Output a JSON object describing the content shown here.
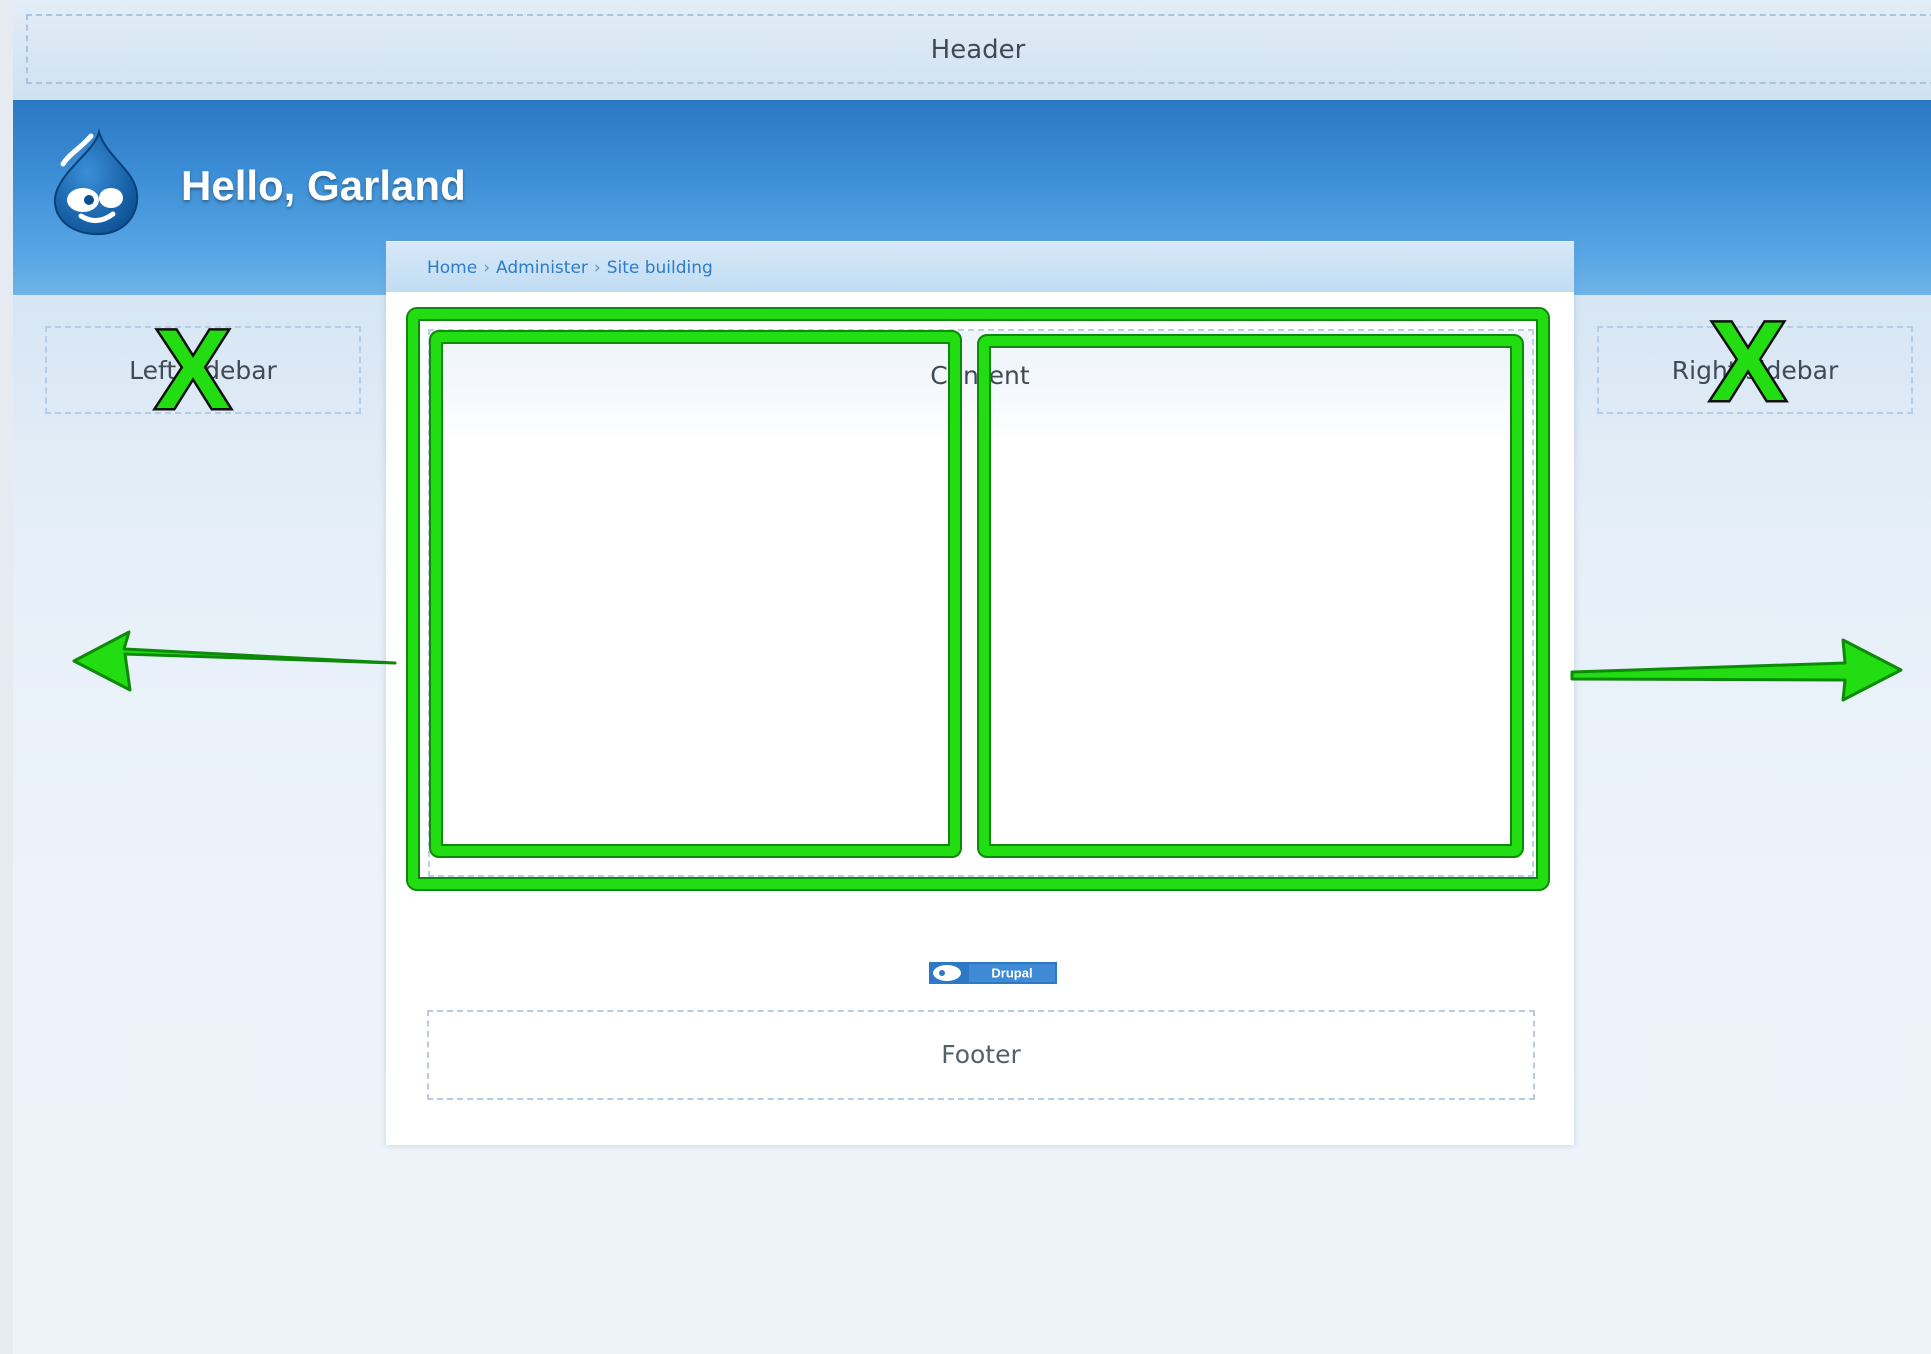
{
  "header": {
    "label": "Header"
  },
  "banner": {
    "site_name": "Hello, Garland",
    "logo": "drupal-drop-logo"
  },
  "breadcrumb": {
    "items": [
      "Home",
      "Administer",
      "Site building"
    ],
    "separator": "›"
  },
  "regions": {
    "left_sidebar": "Left sidebar",
    "right_sidebar": "Right sidebar",
    "content": "Content",
    "footer": "Footer"
  },
  "badge": {
    "label": "Drupal"
  },
  "annotations": {
    "mark_symbol": "X",
    "arrow_left": "arrow-left-icon",
    "arrow_right": "arrow-right-icon",
    "color": "#22dd11"
  },
  "colors": {
    "banner_blue": "#2a78c2",
    "annotation_green": "#22dd11",
    "link_blue": "#2f7bc4"
  }
}
